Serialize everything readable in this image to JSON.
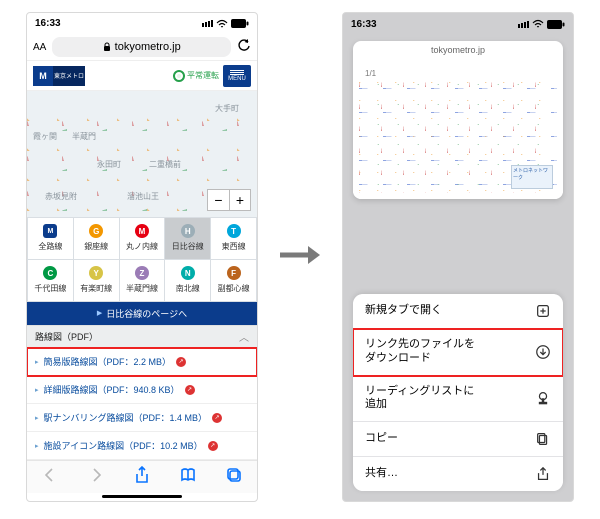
{
  "status": {
    "time": "16:33",
    "timeR": "16:33"
  },
  "addr": {
    "aa": "AA",
    "host": "tokyometro.jp"
  },
  "siteheader": {
    "logo1": "M",
    "logo2": "東京メトロ",
    "opstatus": "平常運転",
    "menu": "MENU"
  },
  "map": {
    "labels": {
      "l1": "大手町",
      "l2": "霞ヶ関",
      "l3": "永田町",
      "l4": "赤坂見附",
      "l5": "二重橋前",
      "l6": "溜池山王",
      "l7": "半蔵門"
    },
    "zoom_minus": "−",
    "zoom_plus": "+"
  },
  "lines": [
    {
      "letter": "M",
      "color": "#0b3c8c",
      "label": "全路線",
      "metro": true
    },
    {
      "letter": "G",
      "color": "#f39700",
      "label": "銀座線"
    },
    {
      "letter": "M",
      "color": "#e60012",
      "label": "丸ノ内線"
    },
    {
      "letter": "H",
      "color": "#9caeb7",
      "label": "日比谷線",
      "selected": true
    },
    {
      "letter": "T",
      "color": "#00a7db",
      "label": "東西線"
    },
    {
      "letter": "C",
      "color": "#009944",
      "label": "千代田線"
    },
    {
      "letter": "Y",
      "color": "#d7c447",
      "label": "有楽町線"
    },
    {
      "letter": "Z",
      "color": "#9b7cb6",
      "label": "半蔵門線"
    },
    {
      "letter": "N",
      "color": "#00ada9",
      "label": "南北線"
    },
    {
      "letter": "F",
      "color": "#bb641d",
      "label": "副都心線"
    }
  ],
  "pagelink": "日比谷線のページへ",
  "pdf": {
    "head": "路線図（PDF）",
    "items": [
      {
        "label": "簡易版路線図（PDF：2.2 MB）",
        "highlight": true
      },
      {
        "label": "詳細版路線図（PDF：940.8 KB）"
      },
      {
        "label": "駅ナンバリング路線図（PDF：1.4 MB）"
      },
      {
        "label": "施設アイコン路線図（PDF：10.2 MB）"
      }
    ]
  },
  "tabcard": {
    "host": "tokyometro.jp",
    "page": "1/1",
    "legend": "メトロネットワーク"
  },
  "ctxmenu": [
    {
      "label": "新規タブで開く",
      "icon": "newtab"
    },
    {
      "label": "リンク先のファイルを\nダウンロード",
      "icon": "download",
      "highlight": true
    },
    {
      "label": "リーディングリストに\n追加",
      "icon": "readlist"
    },
    {
      "label": "コピー",
      "icon": "copy"
    },
    {
      "label": "共有…",
      "icon": "share"
    }
  ]
}
